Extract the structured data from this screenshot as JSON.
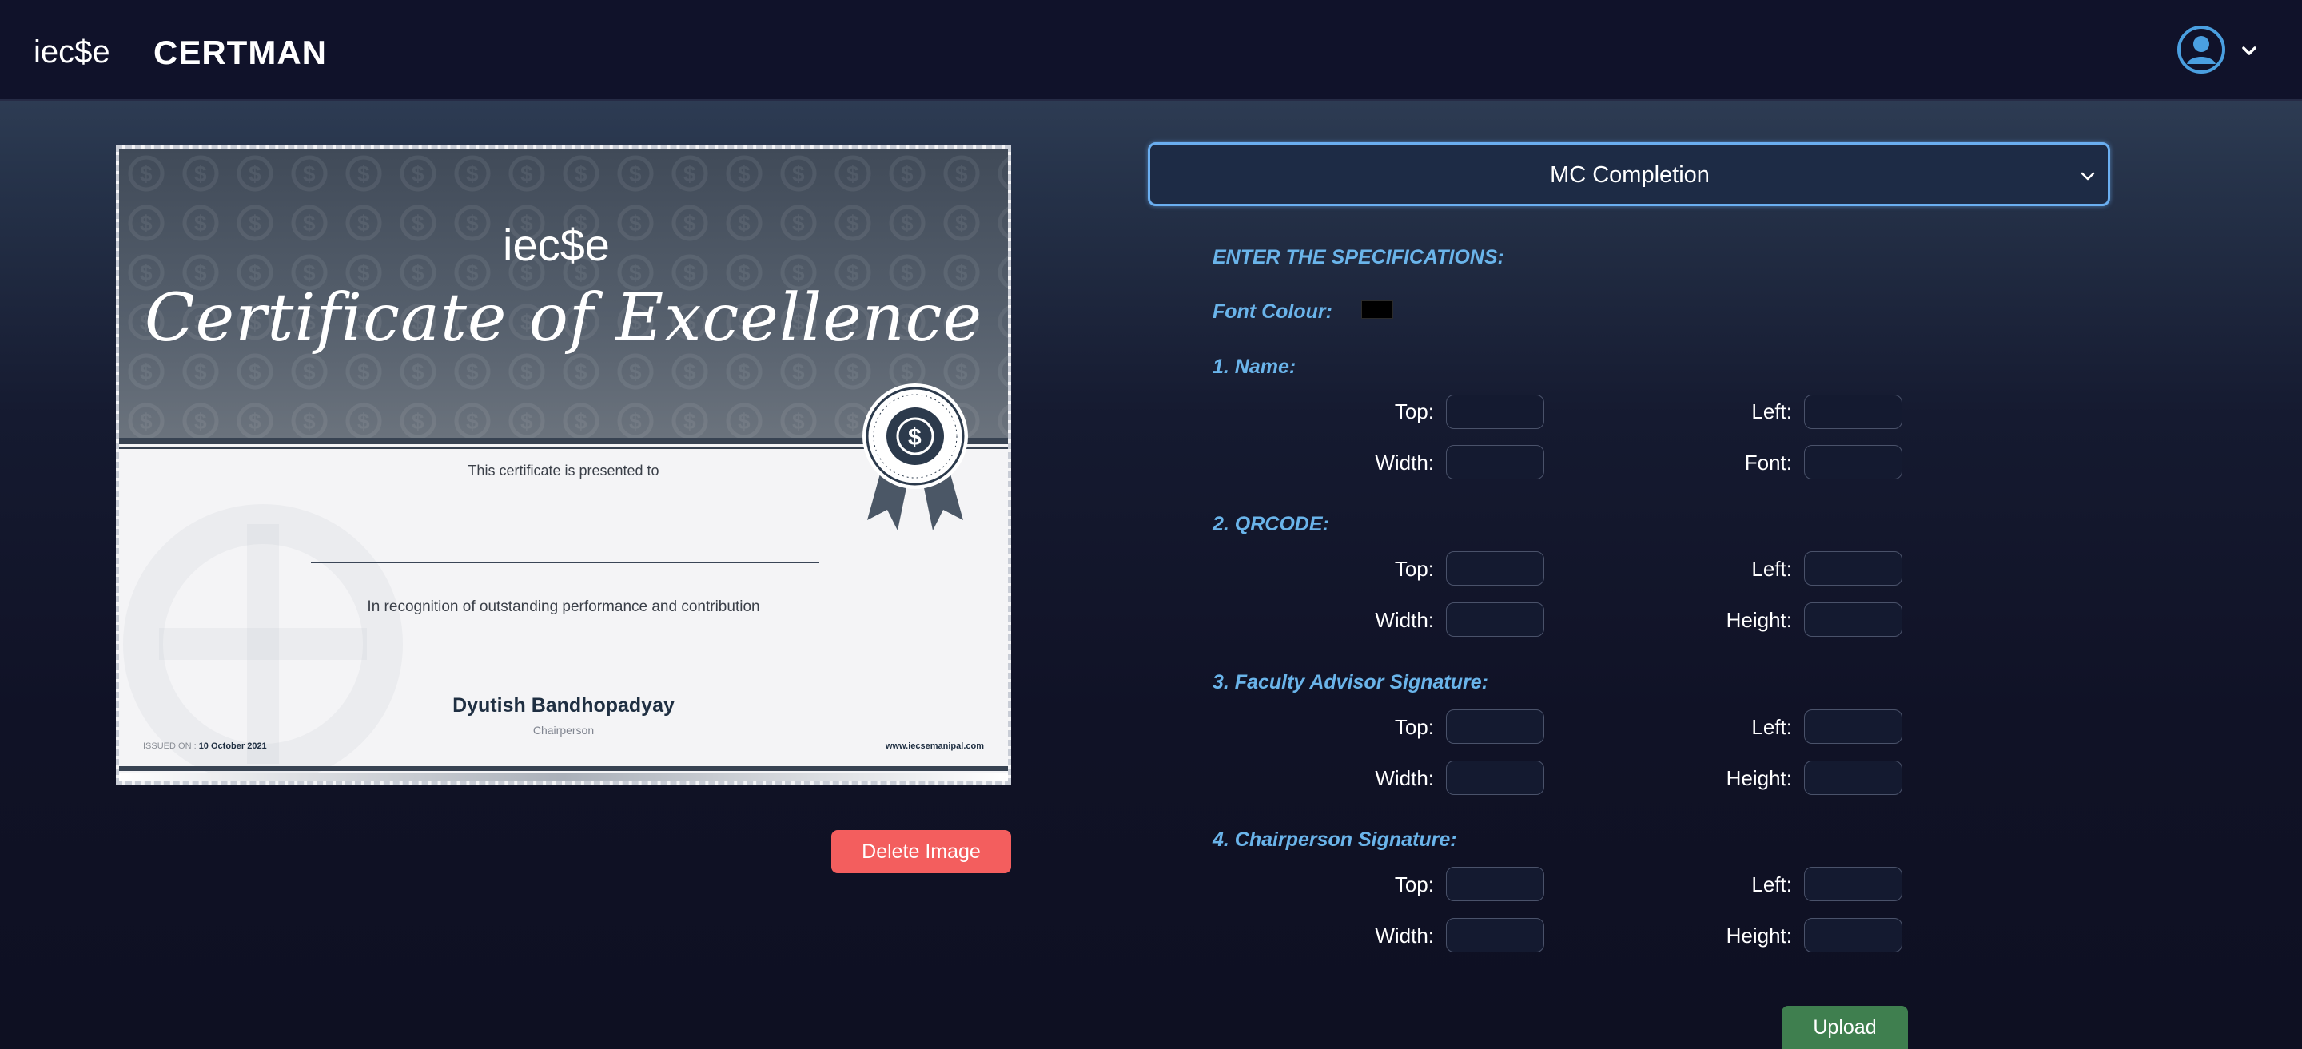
{
  "header": {
    "logo_text": "iec$e",
    "brand": "CERTMAN"
  },
  "certificate": {
    "logo_text": "iec$e",
    "title": "Certificate of Excellence",
    "presented": "This certificate is presented to",
    "recognition": "In recognition of outstanding performance and contribution",
    "signatory_name": "Dyutish Bandhopadyay",
    "signatory_role": "Chairperson",
    "issued_label": "ISSUED ON :",
    "issued_date": "10 October 2021",
    "website": "www.iecsemanipal.com"
  },
  "actions": {
    "delete_label": "Delete Image",
    "upload_label": "Upload"
  },
  "template_select": {
    "selected": "MC Completion"
  },
  "form": {
    "title": "ENTER THE SPECIFICATIONS:",
    "font_colour_label": "Font Colour:",
    "font_colour_value": "#000000",
    "sections": [
      {
        "label": "1. Name:",
        "fields": [
          "Top:",
          "Left:",
          "Width:",
          "Font:"
        ]
      },
      {
        "label": "2. QRCODE:",
        "fields": [
          "Top:",
          "Left:",
          "Width:",
          "Height:"
        ]
      },
      {
        "label": "3. Faculty Advisor Signature:",
        "fields": [
          "Top:",
          "Left:",
          "Width:",
          "Height:"
        ]
      },
      {
        "label": "4. Chairperson Signature:",
        "fields": [
          "Top:",
          "Left:",
          "Width:",
          "Height:"
        ]
      }
    ]
  },
  "colors": {
    "header_bg": "#10122a",
    "accent_blue": "#6ab4ea",
    "delete_red": "#f35e5e",
    "upload_green": "#3f7f4f"
  }
}
